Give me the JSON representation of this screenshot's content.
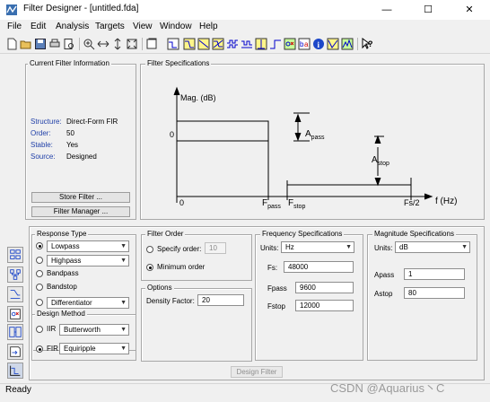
{
  "window": {
    "title": "Filter Designer - [untitled.fda]",
    "minimize": "—",
    "maximize": "☐",
    "close": "✕"
  },
  "menu": [
    "File",
    "Edit",
    "Analysis",
    "Targets",
    "View",
    "Window",
    "Help"
  ],
  "toolbar_icons": [
    "new-icon",
    "open-icon",
    "save-icon",
    "print-icon",
    "print-preview-icon",
    "zoom-in-icon",
    "zoom-x-icon",
    "zoom-y-icon",
    "full-view-icon",
    "new-figure-icon",
    "filter-specs-icon",
    "magnitude-response-icon",
    "phase-response-icon",
    "mag-phase-icon",
    "group-delay-icon",
    "phase-delay-icon",
    "impulse-response-icon",
    "step-response-icon",
    "pole-zero-icon",
    "coefficients-icon",
    "info-icon",
    "magnitude-estimate-icon",
    "noise-power-icon",
    "whats-this-icon"
  ],
  "current_filter": {
    "title": "Current Filter Information",
    "rows": [
      {
        "label": "Structure:",
        "value": "Direct-Form FIR"
      },
      {
        "label": "Order:",
        "value": "50"
      },
      {
        "label": "Stable:",
        "value": "Yes"
      },
      {
        "label": "Source:",
        "value": "Designed"
      }
    ],
    "store_button": "Store Filter ...",
    "manager_button": "Filter Manager ..."
  },
  "specs_plot": {
    "title": "Filter Specifications",
    "y_label": "Mag. (dB)",
    "zero_label": "0",
    "x_zero": "0",
    "fpass": "F",
    "fpass_sub": "pass",
    "fstop": "F",
    "fstop_sub": "stop",
    "fs2": "Fs/2",
    "f_axis": "f (Hz)",
    "apass": "A",
    "apass_sub": "pass",
    "astop": "A",
    "astop_sub": "stop"
  },
  "response_type": {
    "title": "Response Type",
    "lowpass": "Lowpass",
    "highpass": "Highpass",
    "bandpass": "Bandpass",
    "bandstop": "Bandstop",
    "differentiator": "Differentiator"
  },
  "design_method": {
    "title": "Design Method",
    "iir": "IIR",
    "iir_type": "Butterworth",
    "fir": "FIR",
    "fir_type": "Equiripple"
  },
  "filter_order": {
    "title": "Filter Order",
    "specify": "Specify order:",
    "specify_value": "10",
    "minimum": "Minimum order"
  },
  "options": {
    "title": "Options",
    "density_label": "Density Factor:",
    "density_value": "20"
  },
  "frequency_specs": {
    "title": "Frequency Specifications",
    "units_label": "Units:",
    "units_value": "Hz",
    "fs_label": "Fs:",
    "fs_value": "48000",
    "fpass_label": "Fpass",
    "fpass_value": "9600",
    "fstop_label": "Fstop",
    "fstop_value": "12000"
  },
  "magnitude_specs": {
    "title": "Magnitude Specifications",
    "units_label": "Units:",
    "units_value": "dB",
    "apass_label": "Apass",
    "apass_value": "1",
    "astop_label": "Astop",
    "astop_value": "80"
  },
  "design_button": "Design Filter",
  "status": "Ready",
  "watermark": "CSDN @Aquarius丶C"
}
